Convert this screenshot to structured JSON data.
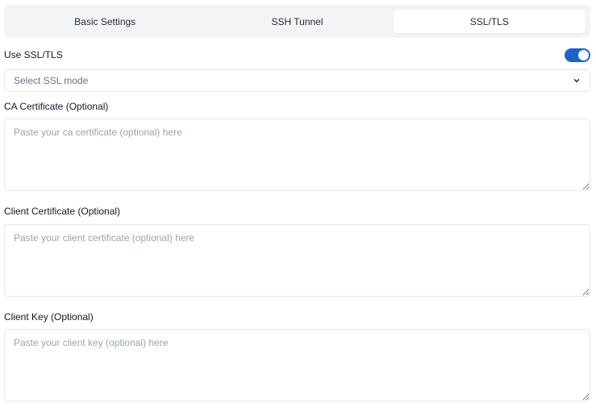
{
  "tabs": [
    {
      "label": "Basic Settings",
      "active": false
    },
    {
      "label": "SSH Tunnel",
      "active": false
    },
    {
      "label": "SSL/TLS",
      "active": true
    }
  ],
  "ssl": {
    "label": "Use SSL/TLS",
    "enabled": true
  },
  "ssl_mode": {
    "placeholder": "Select SSL mode",
    "icon": "chevron-down-icon"
  },
  "fields": {
    "ca": {
      "label": "CA Certificate (Optional)",
      "placeholder": "Paste your ca certificate (optional) here",
      "value": ""
    },
    "client_cert": {
      "label": "Client Certificate (Optional)",
      "placeholder": "Paste your client certificate (optional) here",
      "value": ""
    },
    "client_key": {
      "label": "Client Key (Optional)",
      "placeholder": "Paste your client key (optional) here",
      "value": ""
    }
  },
  "colors": {
    "accent": "#1e63c8",
    "tab_bg": "#f3f4f6",
    "border": "#e5e7eb"
  }
}
